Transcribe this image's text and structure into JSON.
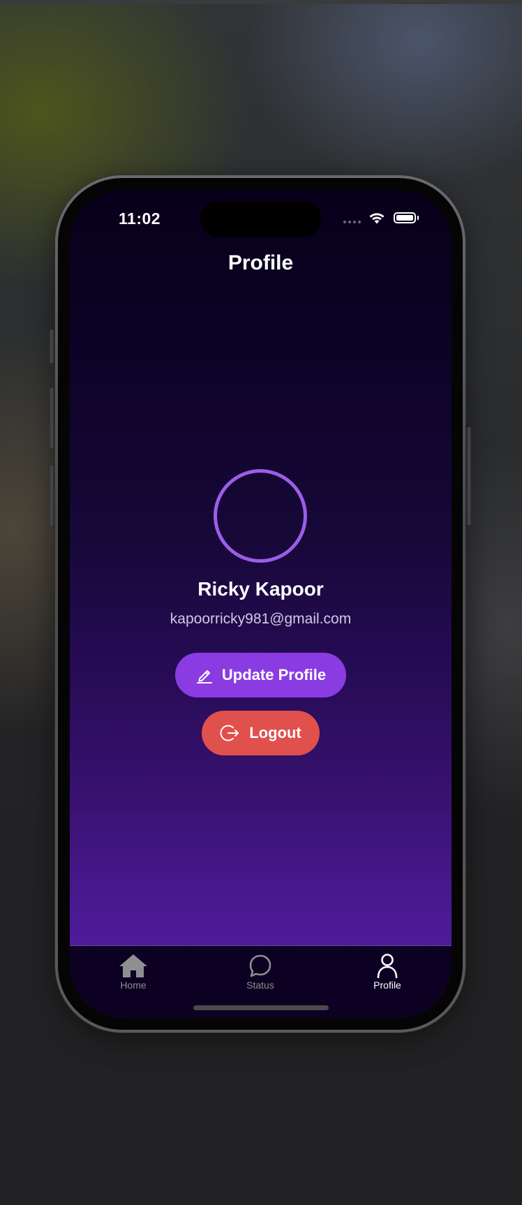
{
  "status_bar": {
    "time": "11:02",
    "icons": [
      "cellular-signal-icon",
      "wifi-icon",
      "battery-icon"
    ],
    "battery_level": 1.0
  },
  "header": {
    "title": "Profile"
  },
  "profile": {
    "name": "Ricky Kapoor",
    "email": "kapoorricky981@gmail.com",
    "avatar_ring_color": "#9b5ee8"
  },
  "actions": {
    "update": {
      "label": "Update Profile",
      "icon": "pencil-icon",
      "color": "#8a3ce2"
    },
    "logout": {
      "label": "Logout",
      "icon": "logout-icon",
      "color": "#e0504c"
    }
  },
  "tab_bar": {
    "active": "Profile",
    "items": [
      {
        "label": "Home",
        "icon": "home-icon"
      },
      {
        "label": "Status",
        "icon": "chat-bubble-icon"
      },
      {
        "label": "Profile",
        "icon": "person-icon"
      }
    ]
  },
  "colors": {
    "background_top": "#08001a",
    "background_bottom": "#561ca3",
    "tab_bar": "#0c0122",
    "tab_inactive": "#8e8e93",
    "tab_active": "#ffffff"
  }
}
